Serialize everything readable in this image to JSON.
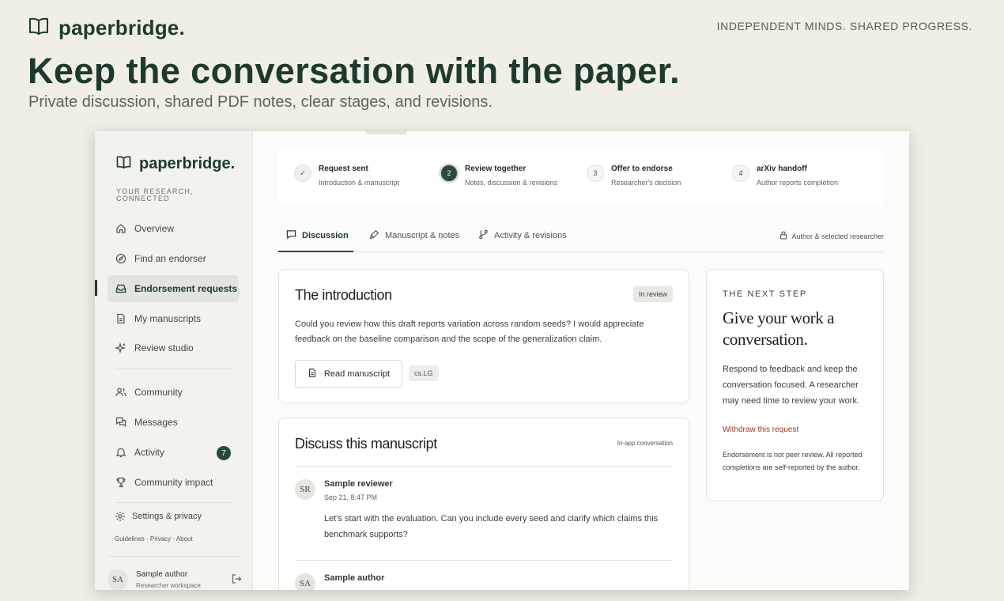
{
  "hero": {
    "brand": "paperbridge.",
    "tagline": "INDEPENDENT MINDS. SHARED PROGRESS.",
    "title": "Keep the conversation with the paper.",
    "subtitle": "Private discussion, shared PDF notes, clear stages, and revisions."
  },
  "sidebar": {
    "brand": "paperbridge.",
    "caption": "YOUR RESEARCH, CONNECTED",
    "items": [
      {
        "label": "Overview",
        "icon": "home-icon"
      },
      {
        "label": "Find an endorser",
        "icon": "compass-icon"
      },
      {
        "label": "Endorsement requests",
        "icon": "inbox-icon",
        "active": true
      },
      {
        "label": "My manuscripts",
        "icon": "document-icon"
      },
      {
        "label": "Review studio",
        "icon": "sparkle-icon"
      },
      {
        "label": "Community",
        "icon": "people-icon"
      },
      {
        "label": "Messages",
        "icon": "messages-icon"
      },
      {
        "label": "Activity",
        "icon": "bell-icon",
        "badge": "7"
      },
      {
        "label": "Community impact",
        "icon": "trophy-icon"
      }
    ],
    "settings_label": "Settings & privacy",
    "footer_links": "Guidelines · Privacy · About",
    "user": {
      "initials": "SA",
      "name": "Sample author",
      "role": "Researcher workspace"
    }
  },
  "steps": [
    {
      "marker": "✓",
      "title": "Request sent",
      "subtitle": "Introduction & manuscript",
      "state": "done"
    },
    {
      "marker": "2",
      "title": "Review together",
      "subtitle": "Notes, discussion & revisions",
      "state": "current"
    },
    {
      "marker": "3",
      "title": "Offer to endorse",
      "subtitle": "Researcher's decision",
      "state": "upcoming"
    },
    {
      "marker": "4",
      "title": "arXiv handoff",
      "subtitle": "Author reports completion",
      "state": "upcoming"
    }
  ],
  "tabs": [
    {
      "label": "Discussion",
      "active": true
    },
    {
      "label": "Manuscript & notes"
    },
    {
      "label": "Activity & revisions"
    }
  ],
  "privacy_note": "Author & selected researcher",
  "intro": {
    "title": "The introduction",
    "status": "In review",
    "description": "Could you review how this draft reports variation across random seeds? I would appreciate feedback on the baseline comparison and the scope of the generalization claim.",
    "read_button": "Read manuscript",
    "category_tag": "cs.LG"
  },
  "discussion": {
    "title": "Discuss this manuscript",
    "meta": "In-app conversation",
    "comments": [
      {
        "initials": "SR",
        "author": "Sample reviewer",
        "time": "Sep 21, 8:47 PM",
        "text": "Let's start with the evaluation. Can you include every seed and clarify which claims this benchmark supports?"
      },
      {
        "initials": "SA",
        "author": "Sample author",
        "time": "",
        "text": ""
      }
    ]
  },
  "next_step": {
    "eyebrow": "THE NEXT STEP",
    "title": "Give your work a conversation.",
    "description": "Respond to feedback and keep the conversation focused. A researcher may need time to review your work.",
    "withdraw_link": "Withdraw this request",
    "footnote": "Endorsement is not peer review. All reported completions are self-reported by the author."
  },
  "colors": {
    "brand": "#1f3a2c",
    "page_background": "#efefe3",
    "badge": "#2c4a3a",
    "danger_link": "#9b3b2c"
  }
}
